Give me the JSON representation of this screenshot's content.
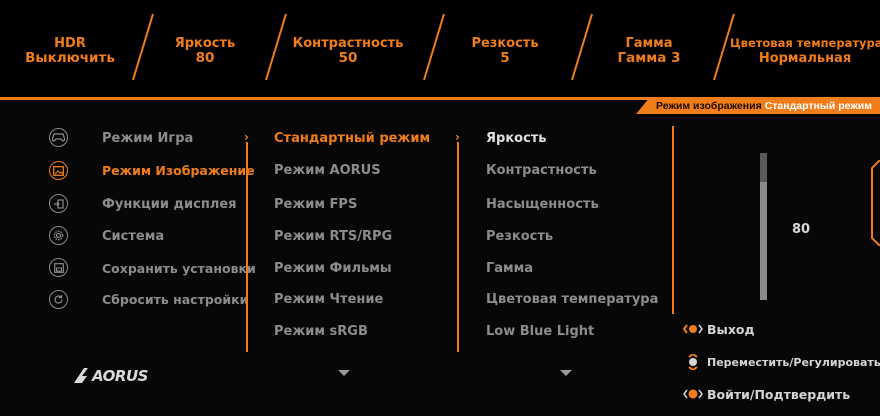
{
  "status_bar": [
    {
      "name": "HDR",
      "value": "Выключить"
    },
    {
      "name": "Яркость",
      "value": "80"
    },
    {
      "name": "Контрастность",
      "value": "50"
    },
    {
      "name": "Резкость",
      "value": "5"
    },
    {
      "name": "Гамма",
      "value": "Гамма 3"
    },
    {
      "name": "Цветовая температура",
      "value": "Нормальная"
    }
  ],
  "breadcrumb": {
    "label": "Режим изображения",
    "value": "Стандартный режим"
  },
  "main_menu": [
    {
      "label": "Режим Игра",
      "icon": "gamepad-icon"
    },
    {
      "label": "Режим Изображение",
      "icon": "picture-icon",
      "active": true
    },
    {
      "label": "Функции дисплея",
      "icon": "display-input-icon"
    },
    {
      "label": "Система",
      "icon": "gear-icon"
    },
    {
      "label": "Сохранить установки",
      "icon": "save-icon"
    },
    {
      "label": "Сбросить настройки",
      "icon": "reset-icon"
    }
  ],
  "picture_modes": [
    {
      "label": "Стандартный режим",
      "active": true
    },
    {
      "label": "Режим AORUS"
    },
    {
      "label": "Режим FPS"
    },
    {
      "label": "Режим RTS/RPG"
    },
    {
      "label": "Режим Фильмы"
    },
    {
      "label": "Режим Чтение"
    },
    {
      "label": "Режим sRGB"
    }
  ],
  "settings": [
    {
      "label": "Яркость",
      "active": true
    },
    {
      "label": "Контрастность"
    },
    {
      "label": "Насыщенность"
    },
    {
      "label": "Резкость"
    },
    {
      "label": "Гамма"
    },
    {
      "label": "Цветовая температура"
    },
    {
      "label": "Low Blue Light"
    }
  ],
  "slider": {
    "value": "80",
    "level": 0.8
  },
  "hints": [
    {
      "label": "Выход",
      "icon": "dpad-left-icon"
    },
    {
      "label": "Переместить/Регулировать",
      "icon": "dpad-updown-icon"
    },
    {
      "label": "Войти/Подтвердить",
      "icon": "dpad-press-icon"
    }
  ],
  "brand": "AORUS",
  "colors": {
    "accent": "#f07d1a",
    "background": "#070707",
    "inactive_text": "#8c8c8c"
  }
}
